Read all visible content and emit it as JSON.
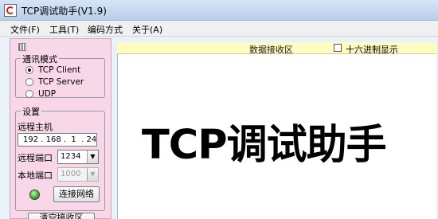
{
  "window": {
    "title": "TCP调试助手(V1.9)"
  },
  "menu": [
    "文件(F)",
    "工具(T)",
    "编码方式",
    "关于(A)"
  ],
  "comm_mode": {
    "label": "通讯模式",
    "options": [
      {
        "label": "TCP Client",
        "checked": true
      },
      {
        "label": "TCP Server",
        "checked": false
      },
      {
        "label": "UDP",
        "checked": false
      }
    ]
  },
  "settings": {
    "label": "设置",
    "remote_host_label": "远程主机",
    "remote_host_value": "192 . 168 .  1  . 24",
    "remote_port_label": "远程端口",
    "remote_port_value": "1234",
    "local_port_label": "本地端口",
    "local_port_value": "1000",
    "connect_button": "连接网络",
    "led_color": "#2f9a2a"
  },
  "clear_button": "清空接收区",
  "receive": {
    "title": "数据接收区",
    "hex_display_label": "十六进制显示",
    "hex_display_checked": false,
    "overlay_text": "TCP调试助手"
  }
}
